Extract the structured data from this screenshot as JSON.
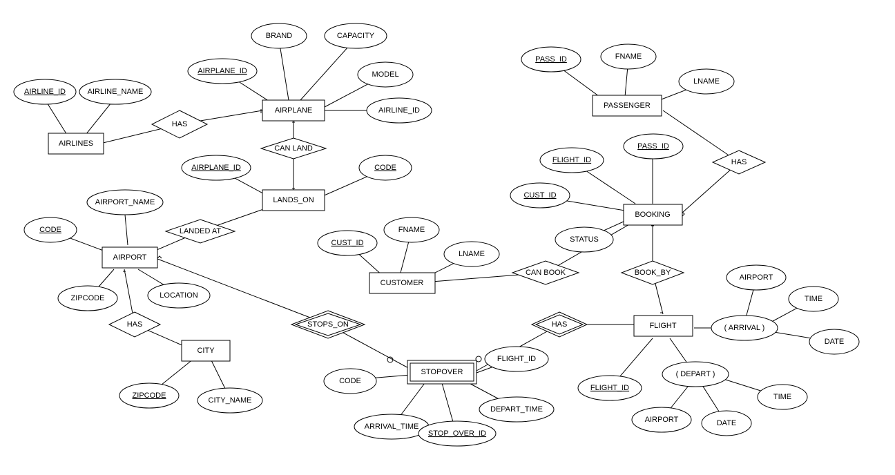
{
  "entities": {
    "airlines": "AIRLINES",
    "airplane": "AIRPLANE",
    "lands_on": "LANDS_ON",
    "airport": "AIRPORT",
    "city": "CITY",
    "customer": "CUSTOMER",
    "booking": "BOOKING",
    "passenger": "PASSENGER",
    "flight": "FLIGHT",
    "stopover": "STOPOVER"
  },
  "relationships": {
    "has_airlines": "HAS",
    "can_land": "CAN LAND",
    "landed_at": "LANDED AT",
    "has_city": "HAS",
    "stops_on": "STOPS_ON",
    "can_book": "CAN BOOK",
    "book_by": "BOOK_BY",
    "has_stopover": "HAS",
    "has_passenger": "HAS"
  },
  "attrs": {
    "airline_id": "AIRLINE_ID",
    "airline_name": "AIRLINE_NAME",
    "airplane_id": "AIRPLANE_ID",
    "brand": "BRAND",
    "capacity": "CAPACITY",
    "model": "MODEL",
    "airline_id2": "AIRLINE_ID",
    "airplane_id2": "AIRPLANE_ID",
    "code": "CODE",
    "code2": "CODE",
    "airport_name": "AIRPORT_NAME",
    "zipcode": "ZIPCODE",
    "location": "LOCATION",
    "zipcode2": "ZIPCODE",
    "city_name": "CITY_NAME",
    "cust_id": "CUST_ID",
    "fname": "FNAME",
    "lname": "LNAME",
    "cust_id2": "CUST_ID",
    "flight_id": "FLIGHT_ID",
    "pass_id": "PASS_ID",
    "status": "STATUS",
    "pass_id2": "PASS_ID",
    "fname2": "FNAME",
    "lname2": "LNAME",
    "flight_id2": "FLIGHT_ID",
    "depart": "( DEPART )",
    "arrival": "( ARRIVAL )",
    "airport_d": "AIRPORT",
    "date_d": "DATE",
    "time_d": "TIME",
    "airport_a": "AIRPORT",
    "date_a": "DATE",
    "time_a": "TIME",
    "stop_over_id": "STOP_OVER_ID",
    "flight_id3": "FLIGHT_ID",
    "code3": "CODE",
    "arrival_time": "ARRIVAL_TIME",
    "depart_time": "DEPART_TIME"
  }
}
